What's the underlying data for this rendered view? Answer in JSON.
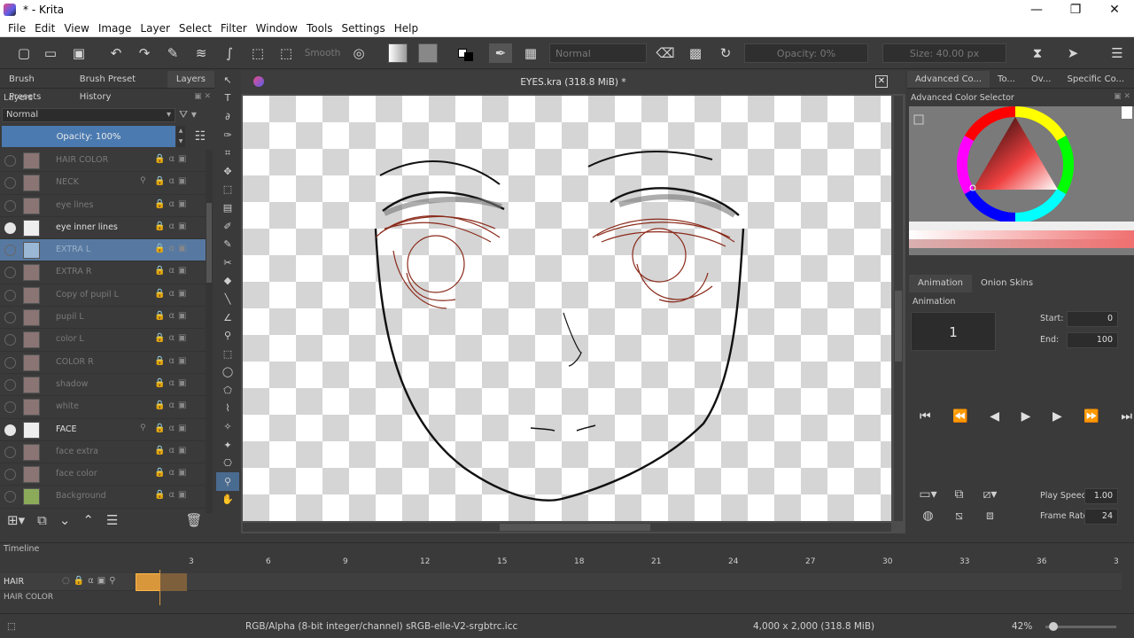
{
  "window": {
    "title": "* - Krita"
  },
  "menu": [
    "File",
    "Edit",
    "View",
    "Image",
    "Layer",
    "Select",
    "Filter",
    "Window",
    "Tools",
    "Settings",
    "Help"
  ],
  "toolbar": {
    "smooth_label": "Smooth",
    "blend_mode": "Normal",
    "opacity": "Opacity: 0%",
    "size": "Size: 40.00 px"
  },
  "left_dock": {
    "tabs": [
      "Brush Presets",
      "Brush Preset History",
      "Layers"
    ],
    "panel_title": "Layers",
    "blend_mode": "Normal",
    "opacity": "Opacity:  100%",
    "layers": [
      {
        "name": "HAIR COLOR",
        "visible": false,
        "selected": false,
        "thumb": "brown",
        "pinned": false
      },
      {
        "name": "NECK",
        "visible": false,
        "selected": false,
        "thumb": "brown",
        "pinned": true
      },
      {
        "name": "eye lines",
        "visible": false,
        "selected": false,
        "thumb": "brown",
        "pinned": false
      },
      {
        "name": "eye inner lines",
        "visible": true,
        "selected": false,
        "thumb": "white",
        "pinned": false
      },
      {
        "name": "EXTRA L",
        "visible": false,
        "selected": true,
        "thumb": "sel",
        "pinned": false
      },
      {
        "name": "EXTRA R",
        "visible": false,
        "selected": false,
        "thumb": "brown",
        "pinned": false
      },
      {
        "name": "Copy of pupil L",
        "visible": false,
        "selected": false,
        "thumb": "brown",
        "pinned": false
      },
      {
        "name": "pupil L",
        "visible": false,
        "selected": false,
        "thumb": "brown",
        "pinned": false
      },
      {
        "name": "color L",
        "visible": false,
        "selected": false,
        "thumb": "brown",
        "pinned": false
      },
      {
        "name": "COLOR R",
        "visible": false,
        "selected": false,
        "thumb": "brown",
        "pinned": false
      },
      {
        "name": "shadow",
        "visible": false,
        "selected": false,
        "thumb": "brown",
        "pinned": false
      },
      {
        "name": "white",
        "visible": false,
        "selected": false,
        "thumb": "brown",
        "pinned": false
      },
      {
        "name": "FACE",
        "visible": true,
        "selected": false,
        "thumb": "white",
        "pinned": true
      },
      {
        "name": "face extra",
        "visible": false,
        "selected": false,
        "thumb": "brown",
        "pinned": false
      },
      {
        "name": "face color",
        "visible": false,
        "selected": false,
        "thumb": "brown",
        "pinned": false
      },
      {
        "name": "Background",
        "visible": false,
        "selected": false,
        "thumb": "green",
        "pinned": false
      }
    ]
  },
  "canvas": {
    "document_title": "EYES.kra (318.8 MiB) *"
  },
  "right_dock": {
    "tabs": [
      "Advanced Co...",
      "To...",
      "Ov...",
      "Specific Co..."
    ],
    "panel_title": "Advanced Color Selector",
    "animation_tabs": [
      "Animation",
      "Onion Skins"
    ],
    "animation_title": "Animation",
    "current_frame": "1",
    "start_label": "Start:",
    "start_value": "0",
    "end_label": "End:",
    "end_value": "100",
    "play_speed_label": "Play Speed:",
    "play_speed_value": "1.00",
    "frame_rate_label": "Frame Rate:",
    "frame_rate_value": "24",
    "accent_color": "#f07070"
  },
  "timeline": {
    "title": "Timeline",
    "ruler": [
      "3",
      "6",
      "9",
      "12",
      "15",
      "18",
      "21",
      "24",
      "27",
      "30",
      "33",
      "36",
      "3"
    ],
    "layers": [
      "HAIR",
      "HAIR COLOR"
    ]
  },
  "status": {
    "color_model": "RGB/Alpha (8-bit integer/channel)  sRGB-elle-V2-srgbtrc.icc",
    "dimensions": "4,000 x 2,000 (318.8 MiB)",
    "zoom": "42%"
  }
}
